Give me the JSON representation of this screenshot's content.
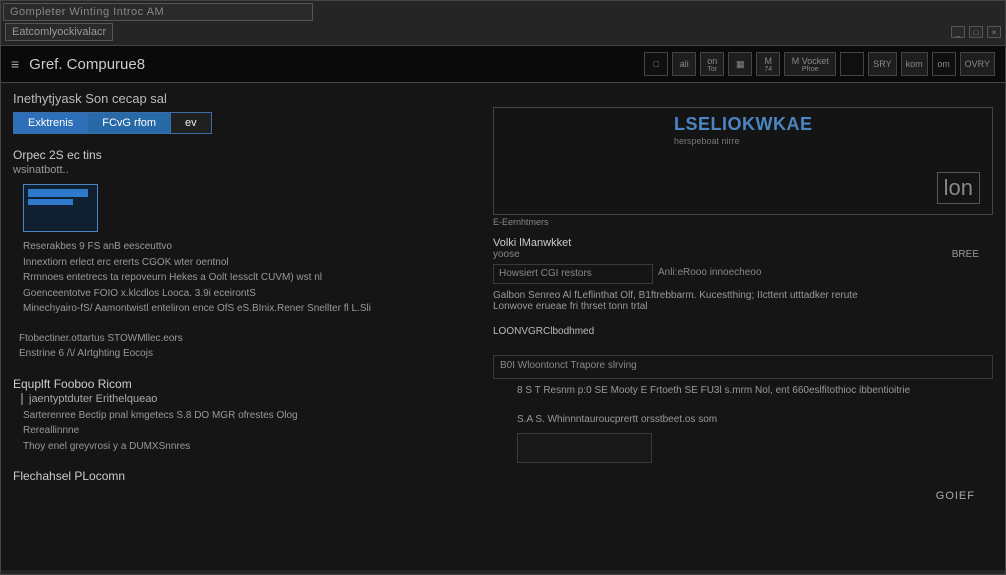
{
  "window": {
    "title1": "Gompleter Winting Introc AM",
    "title2": "Eatcomlyockivalacr",
    "controls": {
      "min": "_",
      "max": "□",
      "close": "×"
    }
  },
  "header": {
    "menu_icon": "≡",
    "title": "Gref. Compurue8",
    "toolbar": [
      {
        "label": "□",
        "sub": ""
      },
      {
        "label": "ali",
        "sub": ""
      },
      {
        "label": "on",
        "sub": "Tor"
      },
      {
        "label": "▦",
        "sub": ""
      },
      {
        "label": "M",
        "sub": "74"
      },
      {
        "label": "M Vocket",
        "sub": "Pfroe"
      },
      {
        "label": "",
        "sub": ""
      },
      {
        "label": "SRY",
        "sub": ""
      },
      {
        "label": "kom",
        "sub": ""
      },
      {
        "label": "om",
        "sub": ""
      },
      {
        "label": "OVRY",
        "sub": ""
      }
    ]
  },
  "left": {
    "page_title": "Inethytjyask Son cecap sal",
    "tabs": [
      {
        "label": "Exktrenis"
      },
      {
        "label": "FCvG rfom"
      },
      {
        "label": "ev"
      }
    ],
    "section1_title": "Orpec 2S ec tins",
    "section1_sub": "wsinatbott..",
    "desc_lines": [
      "Reserakbes 9 FS anB eesceuttvo",
      "Innextiorn erlect erc ererts CGOK wter oentnol",
      "Rrmnoes entetrecs ta repoveurn Hekes  a Oolt  Iessclt CUVM) wst  nl",
      "Goenceentotve  FOIO x.klcdlos Looca. 3.9i eceirontS",
      "Minechyairo-fS/ Aamontwistl enteliron ence OfS  eS.BInix.Rener  Snellter fl  L.Sli"
    ],
    "links": [
      "Ftobectiner.ottartus  STOWMllec.eors",
      "Enstrine 6 /\\/ AIrtghting Eocojs"
    ],
    "item1": {
      "head": "Equplft Fooboo Ricom",
      "sub": "jaentyptduter Erithelqueao",
      "line1": "Sarterenree Bectip  pnal kmgetecs S.8  DO MGR  ofrestes Olog",
      "line2": "Rereallinnne",
      "line3": "Thoy enel greyvrosi y a DUMXSnnres"
    },
    "item2_head": "Flechahsel PLocomn"
  },
  "right": {
    "action_icon": "↪",
    "preview": {
      "title": "LSELIOKWKAE",
      "sub": "herspeboat nirre",
      "logo": "lon",
      "caption": "E-Eernhtmers"
    },
    "field1": {
      "label": "Volki lManwkket",
      "value": "yoose"
    },
    "btn1": "BREE",
    "row1": {
      "left": "Howsiert CGI restors",
      "right": "Anli:eRooo innoecheoo"
    },
    "free1": "Galbon  Senreo Al fLeflinthat  Olf, B1ftrebbarm.  Kucestthing; IIcttent utttadker rerute",
    "free1b": "Lonwove erueae fri thrset tonn trtal",
    "link1": "LOONVGRClbodhmed",
    "field2": {
      "label": "B0I Wloontonct  Trapore slrving"
    },
    "free2": "8 S T  Resnm p:0 SE  Mooty E Frtoeth SE FU3l s.mrm Nol, ent  660eslfitothioc ibbentioitrie",
    "input_caption": "S.A S. Whinnntauroucprertt orsstbeet.os som",
    "go": "GOIEF"
  }
}
